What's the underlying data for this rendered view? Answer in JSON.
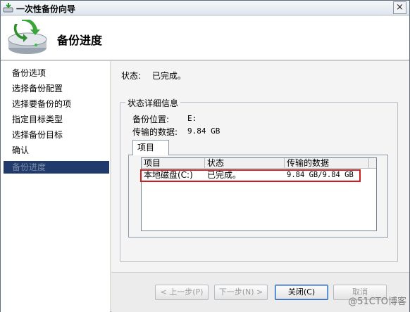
{
  "window": {
    "title": "一次性备份向导",
    "close_glyph": "×"
  },
  "header": {
    "title": "备份进度",
    "icon": "backup-drive-icon"
  },
  "nav": {
    "items": [
      {
        "label": "备份选项",
        "current": false
      },
      {
        "label": "选择备份配置",
        "current": false
      },
      {
        "label": "选择要备份的项",
        "current": false
      },
      {
        "label": "指定目标类型",
        "current": false
      },
      {
        "label": "选择备份目标",
        "current": false
      },
      {
        "label": "确认",
        "current": false
      },
      {
        "label": "备份进度",
        "current": true
      }
    ]
  },
  "status": {
    "label": "状态:",
    "value": "已完成。"
  },
  "details": {
    "legend": "状态详细信息",
    "location_label": "备份位置:",
    "location_value": "E:",
    "transferred_label": "传输的数据:",
    "transferred_value": "9.84 GB",
    "tab_label": "项目",
    "columns": [
      "项目",
      "状态",
      "传输的数据"
    ],
    "rows": [
      {
        "item": "本地磁盘(C:)",
        "status": "已完成。",
        "transferred": "9.84 GB/9.84 GB"
      }
    ]
  },
  "buttons": {
    "back": "< 上一步(P)",
    "next": "下一步(N) >",
    "close": "关闭(C)",
    "cancel": "取消"
  },
  "watermark": "@51CTO博客",
  "colors": {
    "nav_selected_bg": "#1f3a6b",
    "highlight": "#d01c1c",
    "focus": "#2f65a8"
  }
}
